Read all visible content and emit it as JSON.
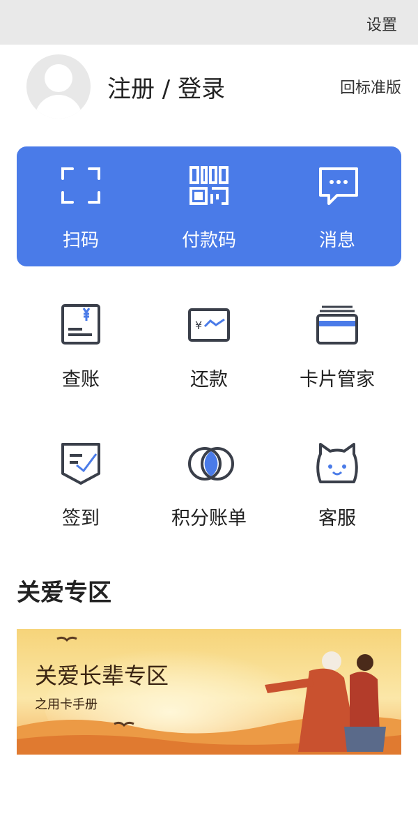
{
  "topbar": {
    "settings_label": "设置"
  },
  "profile": {
    "login_label": "注册 / 登录",
    "standard_label": "回标准版"
  },
  "quick_actions": [
    {
      "label": "扫码",
      "icon": "scan-icon"
    },
    {
      "label": "付款码",
      "icon": "qr-code-icon"
    },
    {
      "label": "消息",
      "icon": "message-icon"
    }
  ],
  "services": [
    {
      "label": "查账",
      "icon": "bill-icon"
    },
    {
      "label": "还款",
      "icon": "repay-icon"
    },
    {
      "label": "卡片管家",
      "icon": "cards-icon"
    },
    {
      "label": "签到",
      "icon": "signin-icon"
    },
    {
      "label": "积分账单",
      "icon": "points-icon"
    },
    {
      "label": "客服",
      "icon": "service-cat-icon"
    }
  ],
  "care": {
    "title": "关爱专区",
    "banner_title": "关爱长辈专区",
    "banner_subtitle": "之用卡手册"
  },
  "colors": {
    "accent": "#4a7be8",
    "icon_stroke": "#3a3f4a",
    "icon_accent": "#4a7be8"
  }
}
